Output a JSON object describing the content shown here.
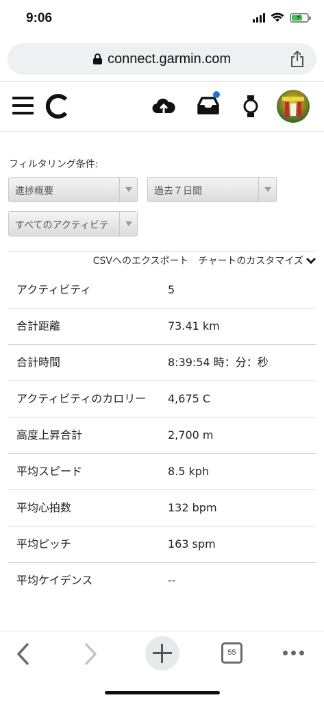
{
  "status": {
    "time": "9:06"
  },
  "browser": {
    "url": "connect.garmin.com",
    "tab_count": "55"
  },
  "filter": {
    "label": "フィルタリング条件:",
    "select_report": "進捗概要",
    "select_period": "過去７日間",
    "select_activity": "すべてのアクティビテ"
  },
  "actions": {
    "export_csv": "CSVへのエクスポート",
    "customize_chart": "チャートのカスタマイズ"
  },
  "summary": [
    {
      "label": "アクティビティ",
      "value": "5"
    },
    {
      "label": "合計距離",
      "value": "73.41 km"
    },
    {
      "label": "合計時間",
      "value": "8:39:54 時：分：秒"
    },
    {
      "label": "アクティビティのカロリー",
      "value": "4,675 C"
    },
    {
      "label": "高度上昇合計",
      "value": "2,700 m"
    },
    {
      "label": "平均スピード",
      "value": "8.5 kph"
    },
    {
      "label": "平均心拍数",
      "value": "132 bpm"
    },
    {
      "label": "平均ピッチ",
      "value": "163 spm"
    },
    {
      "label": "平均ケイデンス",
      "value": "--"
    }
  ],
  "colors": {
    "notification_dot": "#1877d2",
    "battery": "#3bc445"
  },
  "icons": [
    "lock-icon",
    "share-icon",
    "menu-icon",
    "garmin-logo-icon",
    "upload-cloud-icon",
    "inbox-icon",
    "watch-icon",
    "chevron-down-icon",
    "back-icon",
    "forward-icon",
    "plus-icon",
    "tabs-icon",
    "more-icon"
  ]
}
